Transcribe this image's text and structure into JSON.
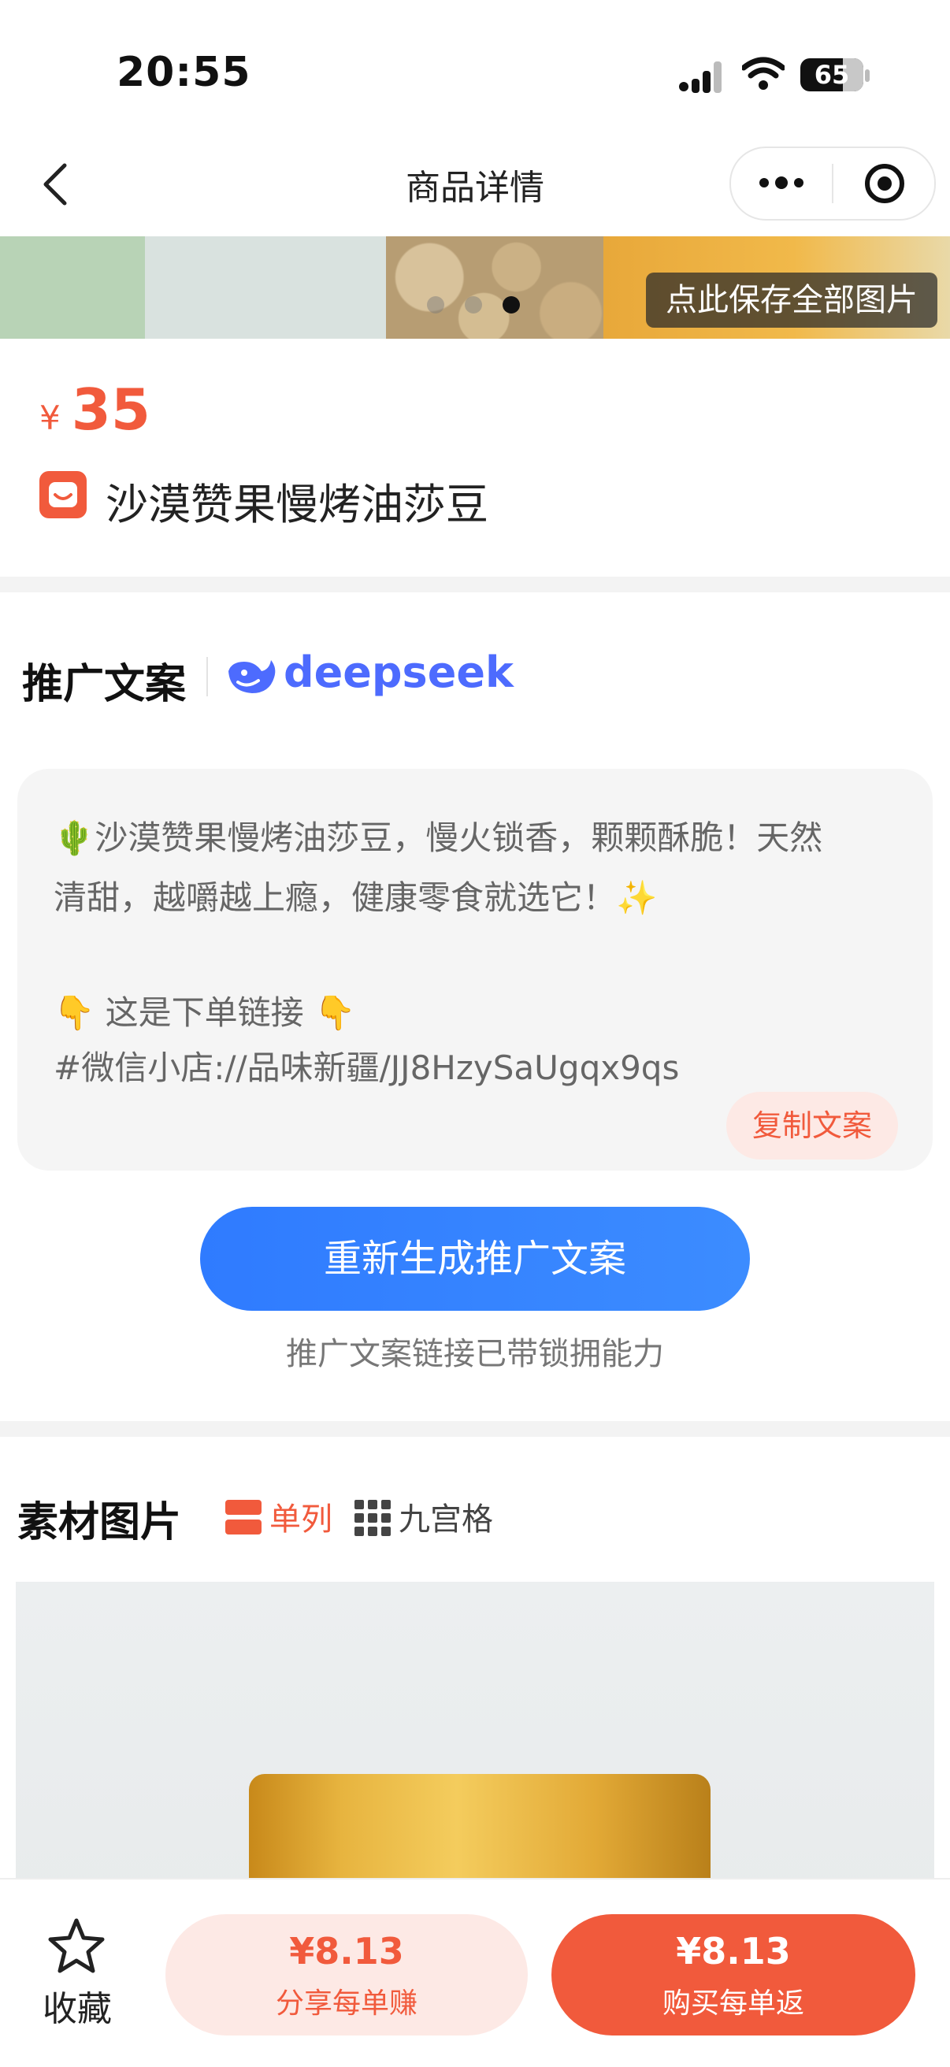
{
  "status_bar": {
    "time": "20:55",
    "battery": "65"
  },
  "nav": {
    "title": "商品详情"
  },
  "banner": {
    "save_all_label": "点此保存全部图片",
    "dot_count": 3,
    "active_dot": 3
  },
  "product": {
    "currency": "¥",
    "price": "35",
    "name": "沙漠赞果慢烤油莎豆"
  },
  "promo": {
    "section_title": "推广文案",
    "ai_brand": "deepseek",
    "line1": "🌵沙漠赞果慢烤油莎豆，慢火锁香，颗颗酥脆！天然",
    "line2": "清甜，越嚼越上瘾，健康零食就选它！✨",
    "line3": "👇 这是下单链接 👇",
    "line4": "#微信小店://品味新疆/JJ8HzySaUgqx9qs",
    "copy_label": "复制文案",
    "regenerate_label": "重新生成推广文案",
    "note": "推广文案链接已带锁拥能力"
  },
  "material": {
    "section_title": "素材图片",
    "tabs": [
      {
        "label": "单列",
        "active": true
      },
      {
        "label": "九宫格",
        "active": false
      }
    ]
  },
  "bottom_bar": {
    "favorite_label": "收藏",
    "share": {
      "amount": "¥8.13",
      "label": "分享每单赚"
    },
    "buy": {
      "amount": "¥8.13",
      "label": "购买每单返"
    }
  },
  "colors": {
    "accent": "#f15a3c",
    "primary_blue": "#3b86ff",
    "deepseek_blue": "#4d6bfe"
  },
  "icons": [
    "back-icon",
    "more-icon",
    "record-icon",
    "signal-icon",
    "wifi-icon",
    "battery-icon",
    "shop-icon",
    "deepseek-whale-icon",
    "single-column-icon",
    "grid-icon",
    "star-icon"
  ]
}
